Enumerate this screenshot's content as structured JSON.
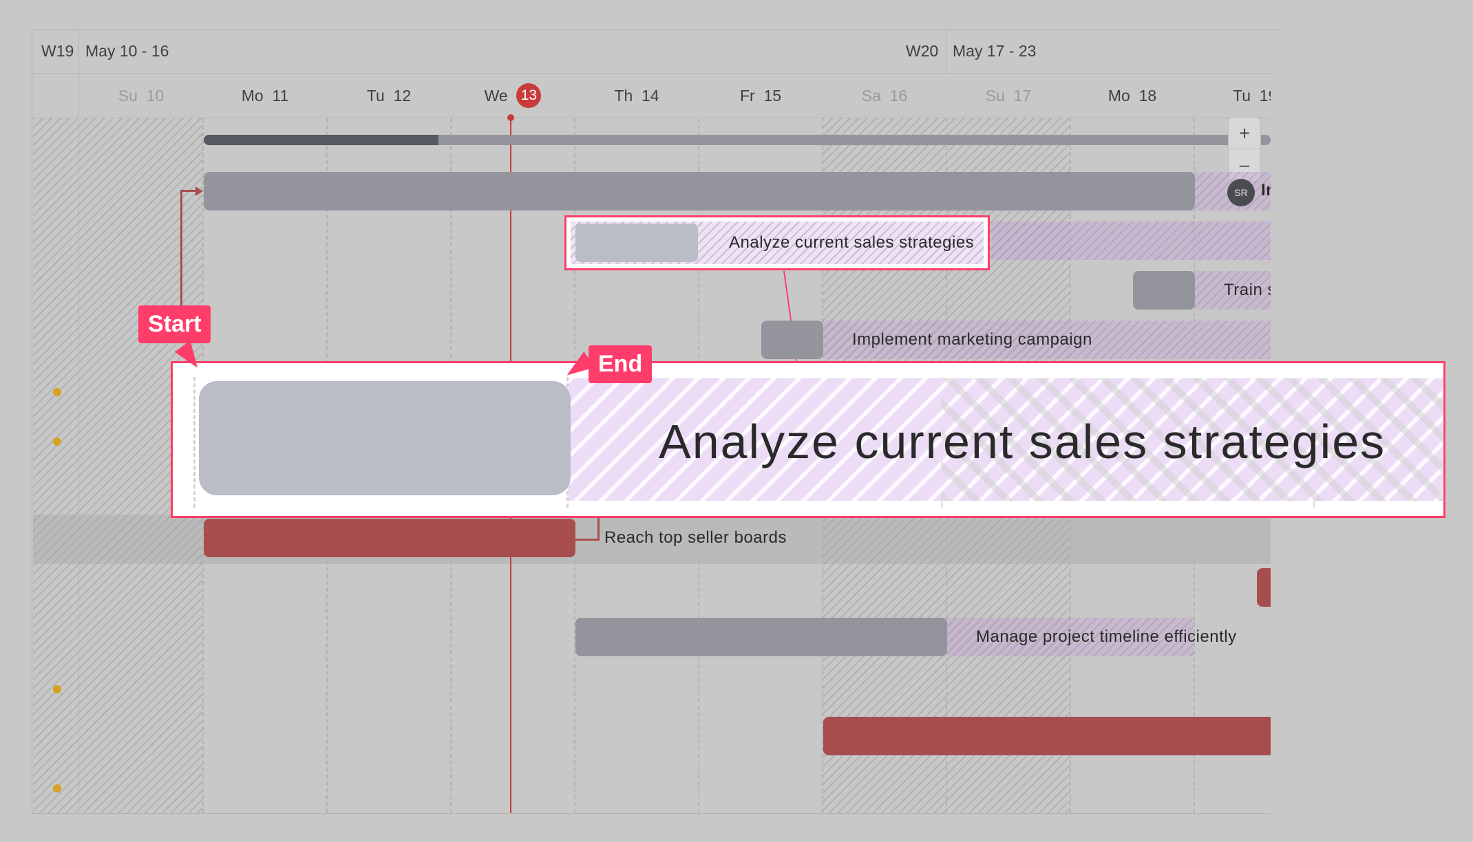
{
  "weeks": [
    {
      "number": "W19",
      "range": "May 10 - 16"
    },
    {
      "number": "W20",
      "range": "May 17 - 23"
    }
  ],
  "days": [
    {
      "dow": "Su",
      "num": "10",
      "weekend": true
    },
    {
      "dow": "Mo",
      "num": "11",
      "weekend": false
    },
    {
      "dow": "Tu",
      "num": "12",
      "weekend": false
    },
    {
      "dow": "We",
      "num": "13",
      "weekend": false,
      "today": true
    },
    {
      "dow": "Th",
      "num": "14",
      "weekend": false
    },
    {
      "dow": "Fr",
      "num": "15",
      "weekend": false
    },
    {
      "dow": "Sa",
      "num": "16",
      "weekend": true
    },
    {
      "dow": "Su",
      "num": "17",
      "weekend": true
    },
    {
      "dow": "Mo",
      "num": "18",
      "weekend": false
    },
    {
      "dow": "Tu",
      "num": "19",
      "weekend": false
    }
  ],
  "zoom": {
    "in": "+",
    "out": "–"
  },
  "avatar": "SR",
  "tasks": {
    "analyze": "Analyze current sales strategies",
    "train": "Train s",
    "implement": "Implement marketing campaign",
    "reach": "Reach top seller boards",
    "manage": "Manage project timeline efficiently",
    "in_trunc": "In"
  },
  "magnifier": {
    "label": "Analyze current sales strategies"
  },
  "callouts": {
    "start": "Start",
    "end": "End"
  },
  "colors": {
    "bar_gray": "#94959c",
    "bar_light": "#babdc5",
    "bar_red": "#a84d4d",
    "today_line": "#c93b3b",
    "highlight": "#ff3d6a",
    "purple_hatch": "#e4d2f2",
    "dot": "#d6a321"
  },
  "progress": {
    "fraction": 0.22
  }
}
